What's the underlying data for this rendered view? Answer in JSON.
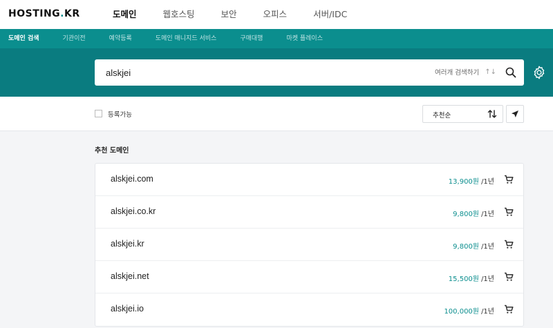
{
  "header": {
    "logo_text": "HOSTING",
    "logo_dot": ".",
    "logo_suffix": "KR",
    "nav": [
      "도메인",
      "웹호스팅",
      "보안",
      "오피스",
      "서버/IDC"
    ]
  },
  "subnav": [
    "도메인 검색",
    "기관이전",
    "예약등록",
    "도메인 매니지드 서비스",
    "구매대행",
    "마켓 플레이스"
  ],
  "search": {
    "value": "alskjei",
    "multi_label": "여러개 검색하기",
    "swap_icon": "↑↓"
  },
  "filter": {
    "available_label": "등록가능",
    "sort_label": "추천순"
  },
  "section_title": "추천 도메인",
  "domains": [
    {
      "name": "alskjei.com",
      "price": "13,900원",
      "period": "/1년"
    },
    {
      "name": "alskjei.co.kr",
      "price": "9,800원",
      "period": "/1년"
    },
    {
      "name": "alskjei.kr",
      "price": "9,800원",
      "period": "/1년"
    },
    {
      "name": "alskjei.net",
      "price": "15,500원",
      "period": "/1년"
    },
    {
      "name": "alskjei.io",
      "price": "100,000원",
      "period": "/1년"
    }
  ],
  "colors": {
    "accent": "#0b8e8e",
    "band": "#0a7c80"
  }
}
